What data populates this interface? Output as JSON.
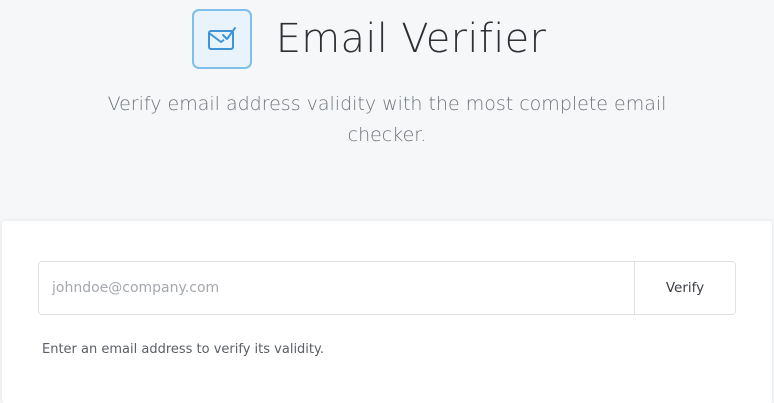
{
  "header": {
    "logo_icon": "envelope-check-icon",
    "title": "Email Verifier",
    "subtitle": "Verify email address validity with the most complete email checker."
  },
  "form": {
    "email_placeholder": "johndoe@company.com",
    "email_value": "",
    "verify_label": "Verify",
    "help_text": "Enter an email address to verify its validity."
  },
  "colors": {
    "accent": "#4aa3df",
    "icon_bg": "#e8f3fb",
    "page_bg": "#f6f7f8"
  }
}
